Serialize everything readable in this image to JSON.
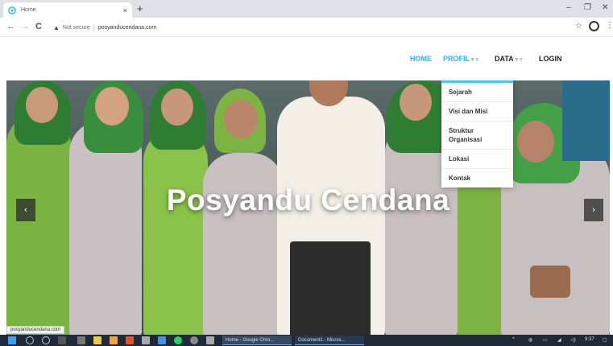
{
  "browser": {
    "tab_title": "Home",
    "tab_close": "×",
    "new_tab": "+",
    "minimize": "–",
    "maximize": "❐",
    "close": "✕",
    "back": "←",
    "forward": "→",
    "reload": "C",
    "security_icon": "▲",
    "security_label": "Not secure",
    "separator": "|",
    "url": "posyanducendana.com",
    "bookmark": "☆",
    "menu": "⋮"
  },
  "nav": {
    "home": "HOME",
    "profil": "PROFIL",
    "data": "DATA",
    "login": "LOGIN",
    "caret": "▾ ▿",
    "colors": {
      "active": "#29b6f6",
      "default": "#222222"
    }
  },
  "dropdown": {
    "items": [
      "Sejarah",
      "Visi dan Misi",
      "Struktur Organisasi",
      "Lokasi",
      "Kontak"
    ]
  },
  "hero": {
    "title": "Posyandu Cendana",
    "prev": "‹",
    "next": "›"
  },
  "status_bar": {
    "url": "posyanducendana.com"
  },
  "taskbar": {
    "chrome_app": "Home - Google Chro...",
    "word_app": "Document1 - Micros...",
    "time": "9:37"
  }
}
